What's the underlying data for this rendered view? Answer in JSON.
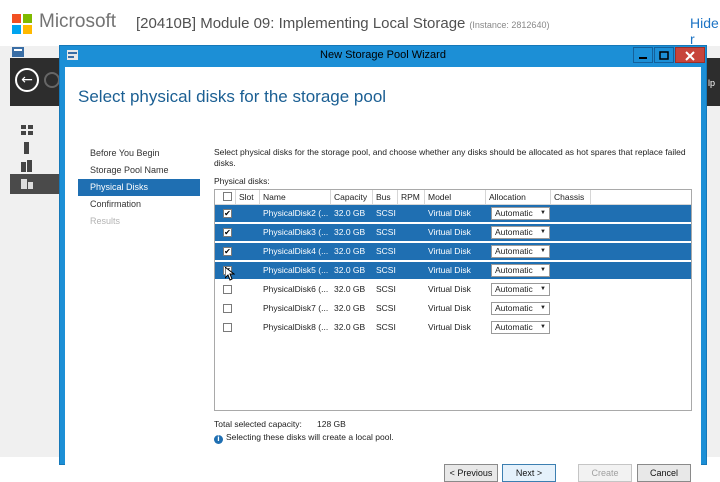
{
  "lab": {
    "brand": "Microsoft",
    "title": "[20410B] Module 09: Implementing Local Storage",
    "instance": "(Instance: 2812640)",
    "hide_label": "Hide r"
  },
  "background": {
    "right_fragment": "lp"
  },
  "dialog": {
    "title": "New Storage Pool Wizard",
    "page_title": "Select physical disks for the storage pool",
    "steps": [
      {
        "label": "Before You Begin",
        "state": "normal"
      },
      {
        "label": "Storage Pool Name",
        "state": "normal"
      },
      {
        "label": "Physical Disks",
        "state": "active"
      },
      {
        "label": "Confirmation",
        "state": "normal"
      },
      {
        "label": "Results",
        "state": "disabled"
      }
    ],
    "description": "Select physical disks for the storage pool, and choose whether any disks should be allocated as hot spares that replace failed disks.",
    "physical_disks_label": "Physical disks:",
    "columns": [
      "Slot",
      "Name",
      "Capacity",
      "Bus",
      "RPM",
      "Model",
      "Allocation",
      "Chassis"
    ],
    "rows": [
      {
        "checked": true,
        "slot": "",
        "name": "PhysicalDisk2 (...",
        "capacity": "32.0 GB",
        "bus": "SCSI",
        "rpm": "",
        "model": "Virtual Disk",
        "allocation": "Automatic",
        "chassis": ""
      },
      {
        "checked": true,
        "slot": "",
        "name": "PhysicalDisk3 (...",
        "capacity": "32.0 GB",
        "bus": "SCSI",
        "rpm": "",
        "model": "Virtual Disk",
        "allocation": "Automatic",
        "chassis": ""
      },
      {
        "checked": true,
        "slot": "",
        "name": "PhysicalDisk4 (...",
        "capacity": "32.0 GB",
        "bus": "SCSI",
        "rpm": "",
        "model": "Virtual Disk",
        "allocation": "Automatic",
        "chassis": ""
      },
      {
        "checked": true,
        "slot": "",
        "name": "PhysicalDisk5 (...",
        "capacity": "32.0 GB",
        "bus": "SCSI",
        "rpm": "",
        "model": "Virtual Disk",
        "allocation": "Automatic",
        "chassis": ""
      },
      {
        "checked": false,
        "slot": "",
        "name": "PhysicalDisk6 (...",
        "capacity": "32.0 GB",
        "bus": "SCSI",
        "rpm": "",
        "model": "Virtual Disk",
        "allocation": "Automatic",
        "chassis": ""
      },
      {
        "checked": false,
        "slot": "",
        "name": "PhysicalDisk7 (...",
        "capacity": "32.0 GB",
        "bus": "SCSI",
        "rpm": "",
        "model": "Virtual Disk",
        "allocation": "Automatic",
        "chassis": ""
      },
      {
        "checked": false,
        "slot": "",
        "name": "PhysicalDisk8 (...",
        "capacity": "32.0 GB",
        "bus": "SCSI",
        "rpm": "",
        "model": "Virtual Disk",
        "allocation": "Automatic",
        "chassis": ""
      }
    ],
    "total_capacity_label": "Total selected capacity:",
    "total_capacity_value": "128 GB",
    "info_text": "Selecting these disks will create a local pool.",
    "buttons": {
      "previous": "< Previous",
      "next": "Next >",
      "create": "Create",
      "cancel": "Cancel"
    }
  },
  "colors": {
    "accent": "#1f6fb2",
    "dialog_frame": "#1c8fd6",
    "title_blue": "#1b5f93",
    "close_red": "#c7443b"
  },
  "icons": [
    "microsoft-logo-icon",
    "server-manager-icon",
    "back-arrow-icon",
    "forward-arrow-icon",
    "dashboard-icon",
    "local-server-icon",
    "all-servers-icon",
    "file-storage-icon",
    "wizard-icon",
    "minimize-icon",
    "maximize-icon",
    "close-icon",
    "checkbox-icon",
    "dropdown-arrow-icon",
    "info-icon",
    "mouse-cursor-icon"
  ]
}
